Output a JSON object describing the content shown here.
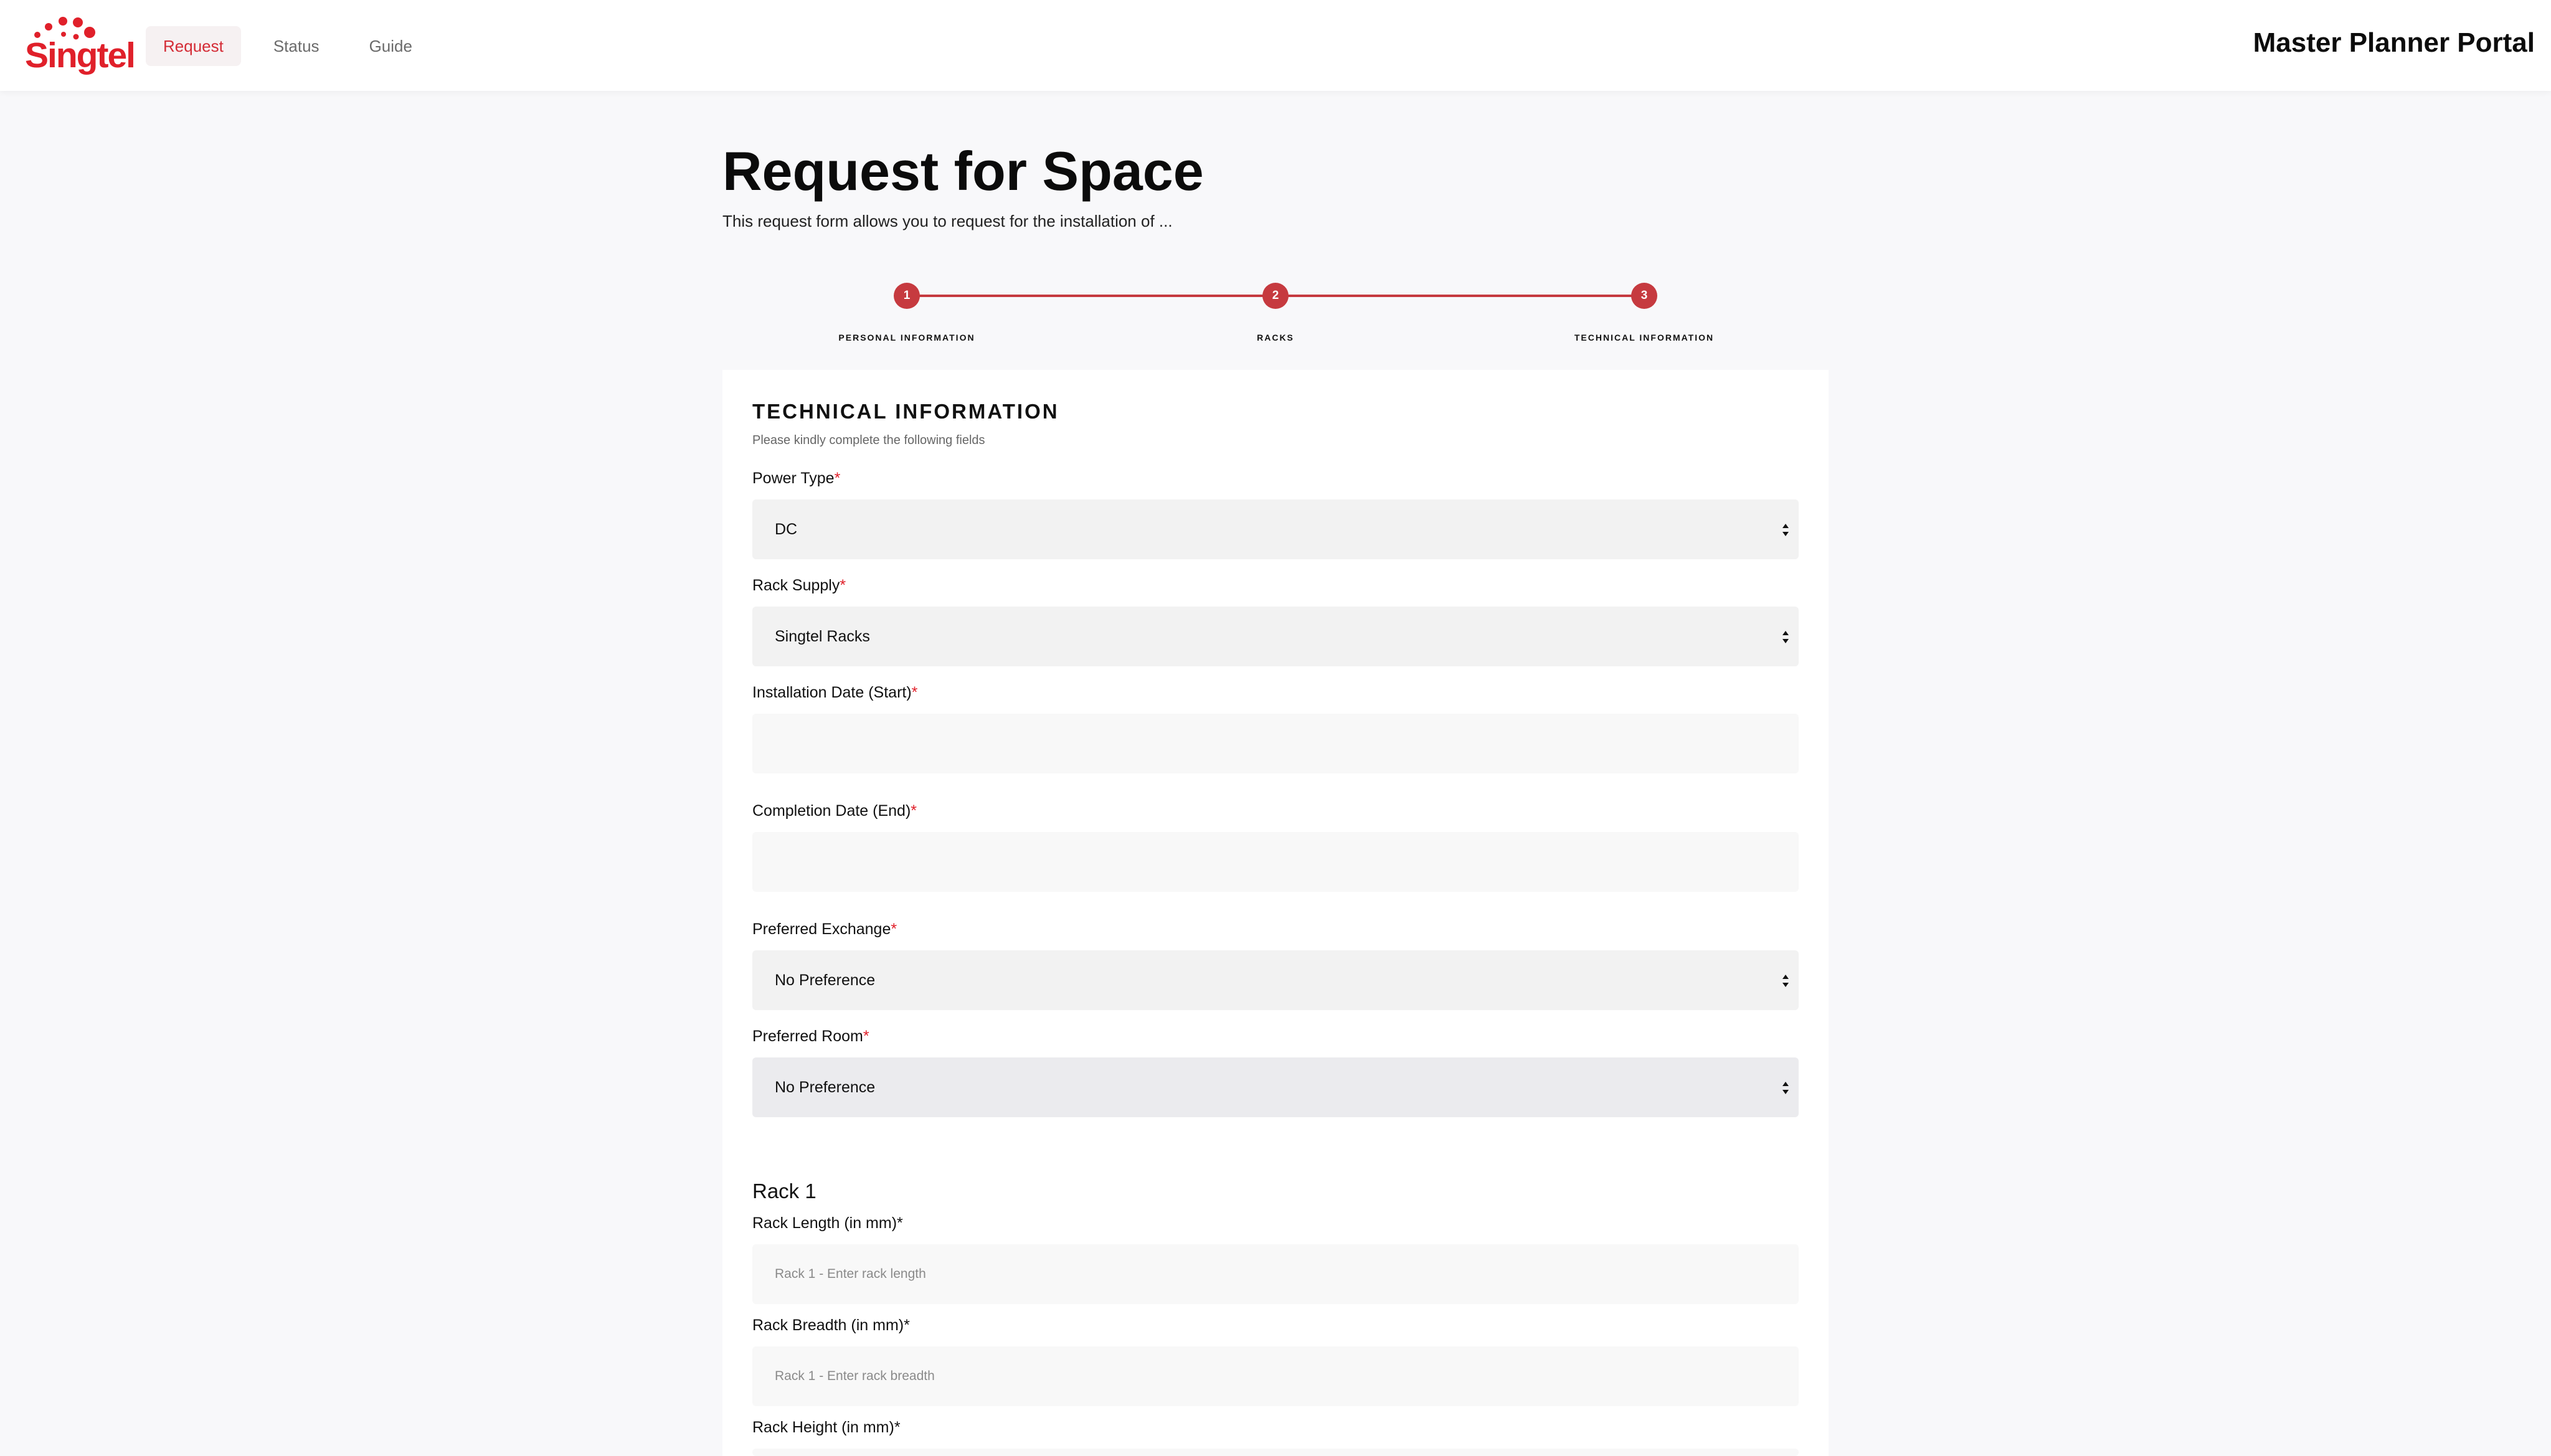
{
  "header": {
    "logo_text": "Singtel",
    "nav": [
      {
        "label": "Request",
        "active": true
      },
      {
        "label": "Status",
        "active": false
      },
      {
        "label": "Guide",
        "active": false
      }
    ],
    "portal_title": "Master Planner Portal"
  },
  "page": {
    "title": "Request for Space",
    "subtitle": "This request form allows you to request for the installation of ..."
  },
  "stepper": {
    "steps": [
      {
        "number": "1",
        "label": "PERSONAL INFORMATION"
      },
      {
        "number": "2",
        "label": "RACKS"
      },
      {
        "number": "3",
        "label": "TECHNICAL INFORMATION"
      }
    ],
    "current_step": 3
  },
  "form": {
    "section_title": "TECHNICAL INFORMATION",
    "section_subtitle": "Please kindly complete the following fields",
    "required_mark": "*",
    "power_type": {
      "label": "Power Type",
      "value": "DC"
    },
    "rack_supply": {
      "label": "Rack Supply",
      "value": "Singtel Racks"
    },
    "installation_date": {
      "label": "Installation Date (Start)",
      "value": ""
    },
    "completion_date": {
      "label": "Completion Date (End)",
      "value": ""
    },
    "preferred_exchange": {
      "label": "Preferred Exchange",
      "value": "No Preference"
    },
    "preferred_room": {
      "label": "Preferred Room",
      "value": "No Preference"
    },
    "rack": {
      "heading": "Rack 1",
      "length": {
        "label": "Rack Length (in mm)*",
        "placeholder": "Rack 1 - Enter rack length"
      },
      "breadth": {
        "label": "Rack Breadth (in mm)*",
        "placeholder": "Rack 1 - Enter rack breadth"
      },
      "height": {
        "label": "Rack Height (in mm)*"
      }
    }
  },
  "colors": {
    "brand_red": "#e0202a",
    "step_red": "#c63a3f",
    "nav_active_bg": "#f6f1f2"
  }
}
